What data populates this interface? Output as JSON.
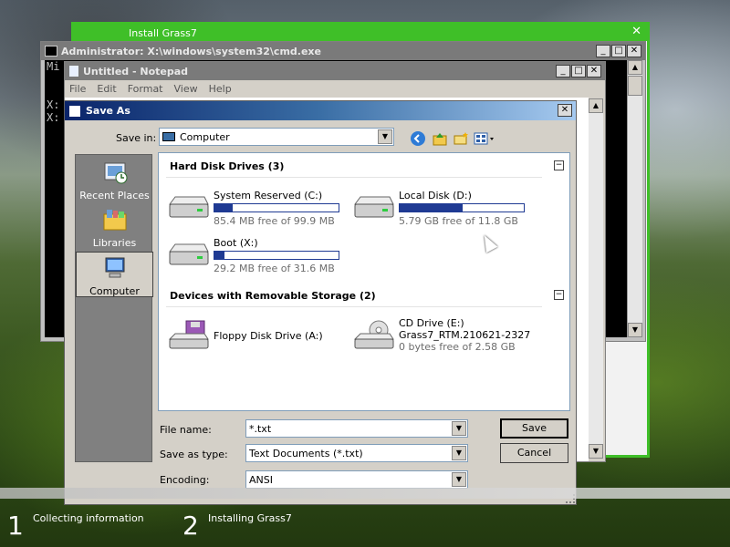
{
  "installer": {
    "title": "Install Grass7",
    "close": "✕"
  },
  "cmd": {
    "title": "Administrator: X:\\windows\\system32\\cmd.exe",
    "lines": [
      "Mi",
      "",
      "",
      "X:",
      "X:"
    ],
    "controls": {
      "min": "_",
      "max": "□",
      "close": "✕"
    }
  },
  "notepad": {
    "title": "Untitled - Notepad",
    "menu": [
      "File",
      "Edit",
      "Format",
      "View",
      "Help"
    ],
    "controls": {
      "min": "_",
      "max": "□",
      "close": "✕"
    }
  },
  "save_as": {
    "title": "Save As",
    "close": "✕",
    "save_in_label": "Save in:",
    "save_in_value": "Computer",
    "places": [
      "Recent Places",
      "Libraries",
      "Computer"
    ],
    "groups": [
      {
        "title": "Hard Disk Drives (3)",
        "collapse": "−",
        "drives": [
          {
            "name": "System Reserved (C:)",
            "free": "85.4 MB free of 99.9 MB",
            "used_fraction": 0.15
          },
          {
            "name": "Local Disk (D:)",
            "free": "5.79 GB free of 11.8 GB",
            "used_fraction": 0.51
          },
          {
            "name": "Boot (X:)",
            "free": "29.2 MB free of 31.6 MB",
            "used_fraction": 0.08
          }
        ]
      },
      {
        "title": "Devices with Removable Storage (2)",
        "collapse": "−",
        "drives": [
          {
            "name": "Floppy Disk Drive (A:)"
          },
          {
            "name": "CD Drive (E:)",
            "label": "Grass7_RTM.210621-2327",
            "free": "0 bytes free of 2.58 GB"
          }
        ]
      }
    ],
    "file_name_label": "File name:",
    "file_name_value": "*.txt",
    "save_type_label": "Save as type:",
    "save_type_value": "Text Documents (*.txt)",
    "encoding_label": "Encoding:",
    "encoding_value": "ANSI",
    "save_button": "Save",
    "cancel_button": "Cancel"
  },
  "setup_steps": [
    {
      "num": "1",
      "text": "Collecting information"
    },
    {
      "num": "2",
      "text": "Installing Grass7"
    }
  ]
}
